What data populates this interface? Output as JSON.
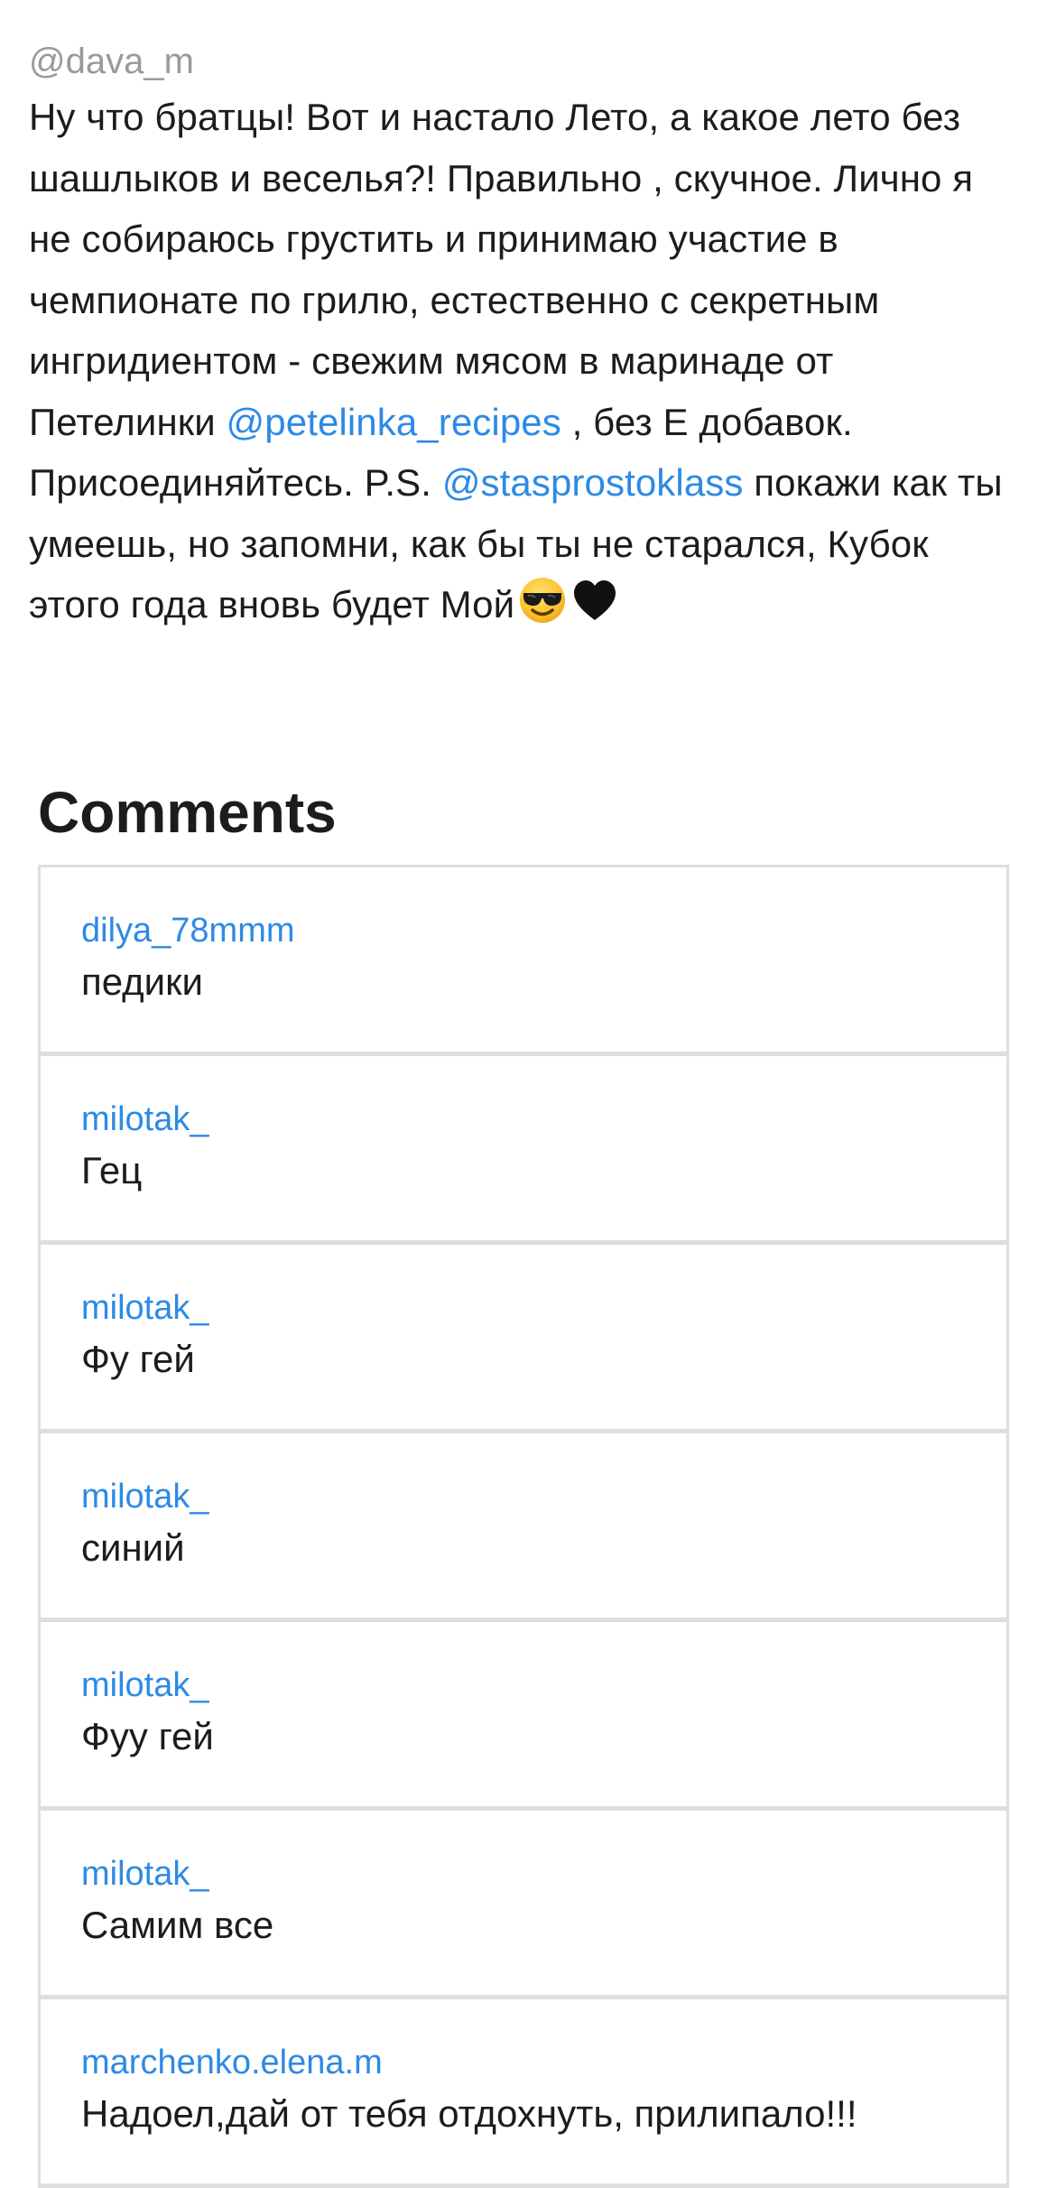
{
  "post": {
    "author": "@dava_m",
    "caption_part1": "Ну что братцы! Вот и настало Лето, а какое лето без шашлыков и веселья?! Правильно , скучное. Лично я не собираюсь грустить и принимаю участие в чемпионате по грилю, естественно с секретным ингридиентом - свежим мясом в маринаде от Петелинки ",
    "mention1": "@petelinka_recipes",
    "caption_part2": " , без Е добавок. Присоединяйтесь. P.S. ",
    "mention2": "@stasprostoklass",
    "caption_part3": " покажи как ты умеешь, но запомни, как бы ты не старался, Кубок этого года вновь будет Мой",
    "emojis": [
      "smiling-face-with-sunglasses-icon",
      "black-heart-icon"
    ]
  },
  "comments_section": {
    "title": "Comments",
    "items": [
      {
        "user": "dilya_78mmm",
        "text": "педики"
      },
      {
        "user": "milotak_",
        "text": "Гец"
      },
      {
        "user": "milotak_",
        "text": "Фу гей"
      },
      {
        "user": "milotak_",
        "text": "синий"
      },
      {
        "user": "milotak_",
        "text": "Фуу гей"
      },
      {
        "user": "milotak_",
        "text": "Самим все"
      },
      {
        "user": "marchenko.elena.m",
        "text": "Надоел,дай от тебя отдохнуть, прилипало!!!"
      }
    ]
  },
  "colors": {
    "link": "#2d8ae5",
    "text": "#1c1c1e",
    "muted": "#9a9a9a",
    "border": "#dedee2"
  }
}
